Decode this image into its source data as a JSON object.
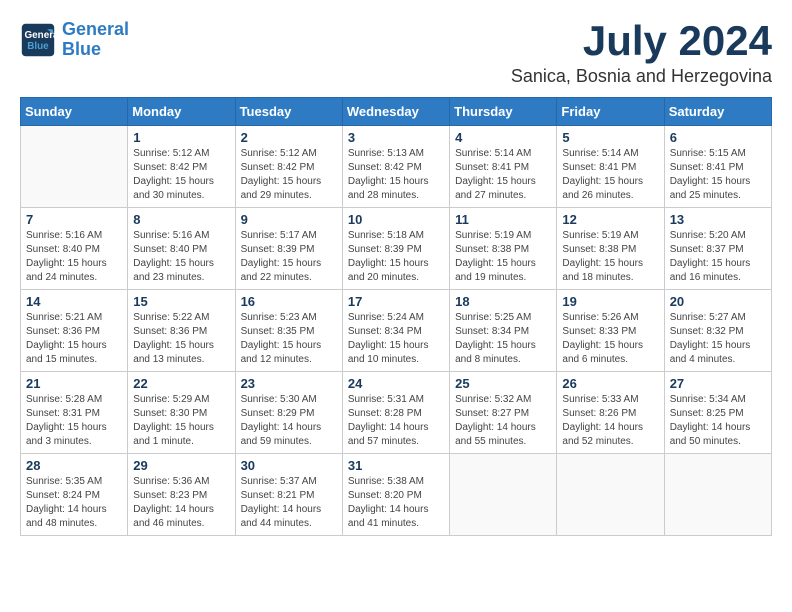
{
  "logo": {
    "line1": "General",
    "line2": "Blue"
  },
  "title": "July 2024",
  "location": "Sanica, Bosnia and Herzegovina",
  "weekdays": [
    "Sunday",
    "Monday",
    "Tuesday",
    "Wednesday",
    "Thursday",
    "Friday",
    "Saturday"
  ],
  "weeks": [
    [
      {
        "day": "",
        "info": ""
      },
      {
        "day": "1",
        "info": "Sunrise: 5:12 AM\nSunset: 8:42 PM\nDaylight: 15 hours\nand 30 minutes."
      },
      {
        "day": "2",
        "info": "Sunrise: 5:12 AM\nSunset: 8:42 PM\nDaylight: 15 hours\nand 29 minutes."
      },
      {
        "day": "3",
        "info": "Sunrise: 5:13 AM\nSunset: 8:42 PM\nDaylight: 15 hours\nand 28 minutes."
      },
      {
        "day": "4",
        "info": "Sunrise: 5:14 AM\nSunset: 8:41 PM\nDaylight: 15 hours\nand 27 minutes."
      },
      {
        "day": "5",
        "info": "Sunrise: 5:14 AM\nSunset: 8:41 PM\nDaylight: 15 hours\nand 26 minutes."
      },
      {
        "day": "6",
        "info": "Sunrise: 5:15 AM\nSunset: 8:41 PM\nDaylight: 15 hours\nand 25 minutes."
      }
    ],
    [
      {
        "day": "7",
        "info": "Sunrise: 5:16 AM\nSunset: 8:40 PM\nDaylight: 15 hours\nand 24 minutes."
      },
      {
        "day": "8",
        "info": "Sunrise: 5:16 AM\nSunset: 8:40 PM\nDaylight: 15 hours\nand 23 minutes."
      },
      {
        "day": "9",
        "info": "Sunrise: 5:17 AM\nSunset: 8:39 PM\nDaylight: 15 hours\nand 22 minutes."
      },
      {
        "day": "10",
        "info": "Sunrise: 5:18 AM\nSunset: 8:39 PM\nDaylight: 15 hours\nand 20 minutes."
      },
      {
        "day": "11",
        "info": "Sunrise: 5:19 AM\nSunset: 8:38 PM\nDaylight: 15 hours\nand 19 minutes."
      },
      {
        "day": "12",
        "info": "Sunrise: 5:19 AM\nSunset: 8:38 PM\nDaylight: 15 hours\nand 18 minutes."
      },
      {
        "day": "13",
        "info": "Sunrise: 5:20 AM\nSunset: 8:37 PM\nDaylight: 15 hours\nand 16 minutes."
      }
    ],
    [
      {
        "day": "14",
        "info": "Sunrise: 5:21 AM\nSunset: 8:36 PM\nDaylight: 15 hours\nand 15 minutes."
      },
      {
        "day": "15",
        "info": "Sunrise: 5:22 AM\nSunset: 8:36 PM\nDaylight: 15 hours\nand 13 minutes."
      },
      {
        "day": "16",
        "info": "Sunrise: 5:23 AM\nSunset: 8:35 PM\nDaylight: 15 hours\nand 12 minutes."
      },
      {
        "day": "17",
        "info": "Sunrise: 5:24 AM\nSunset: 8:34 PM\nDaylight: 15 hours\nand 10 minutes."
      },
      {
        "day": "18",
        "info": "Sunrise: 5:25 AM\nSunset: 8:34 PM\nDaylight: 15 hours\nand 8 minutes."
      },
      {
        "day": "19",
        "info": "Sunrise: 5:26 AM\nSunset: 8:33 PM\nDaylight: 15 hours\nand 6 minutes."
      },
      {
        "day": "20",
        "info": "Sunrise: 5:27 AM\nSunset: 8:32 PM\nDaylight: 15 hours\nand 4 minutes."
      }
    ],
    [
      {
        "day": "21",
        "info": "Sunrise: 5:28 AM\nSunset: 8:31 PM\nDaylight: 15 hours\nand 3 minutes."
      },
      {
        "day": "22",
        "info": "Sunrise: 5:29 AM\nSunset: 8:30 PM\nDaylight: 15 hours\nand 1 minute."
      },
      {
        "day": "23",
        "info": "Sunrise: 5:30 AM\nSunset: 8:29 PM\nDaylight: 14 hours\nand 59 minutes."
      },
      {
        "day": "24",
        "info": "Sunrise: 5:31 AM\nSunset: 8:28 PM\nDaylight: 14 hours\nand 57 minutes."
      },
      {
        "day": "25",
        "info": "Sunrise: 5:32 AM\nSunset: 8:27 PM\nDaylight: 14 hours\nand 55 minutes."
      },
      {
        "day": "26",
        "info": "Sunrise: 5:33 AM\nSunset: 8:26 PM\nDaylight: 14 hours\nand 52 minutes."
      },
      {
        "day": "27",
        "info": "Sunrise: 5:34 AM\nSunset: 8:25 PM\nDaylight: 14 hours\nand 50 minutes."
      }
    ],
    [
      {
        "day": "28",
        "info": "Sunrise: 5:35 AM\nSunset: 8:24 PM\nDaylight: 14 hours\nand 48 minutes."
      },
      {
        "day": "29",
        "info": "Sunrise: 5:36 AM\nSunset: 8:23 PM\nDaylight: 14 hours\nand 46 minutes."
      },
      {
        "day": "30",
        "info": "Sunrise: 5:37 AM\nSunset: 8:21 PM\nDaylight: 14 hours\nand 44 minutes."
      },
      {
        "day": "31",
        "info": "Sunrise: 5:38 AM\nSunset: 8:20 PM\nDaylight: 14 hours\nand 41 minutes."
      },
      {
        "day": "",
        "info": ""
      },
      {
        "day": "",
        "info": ""
      },
      {
        "day": "",
        "info": ""
      }
    ]
  ]
}
